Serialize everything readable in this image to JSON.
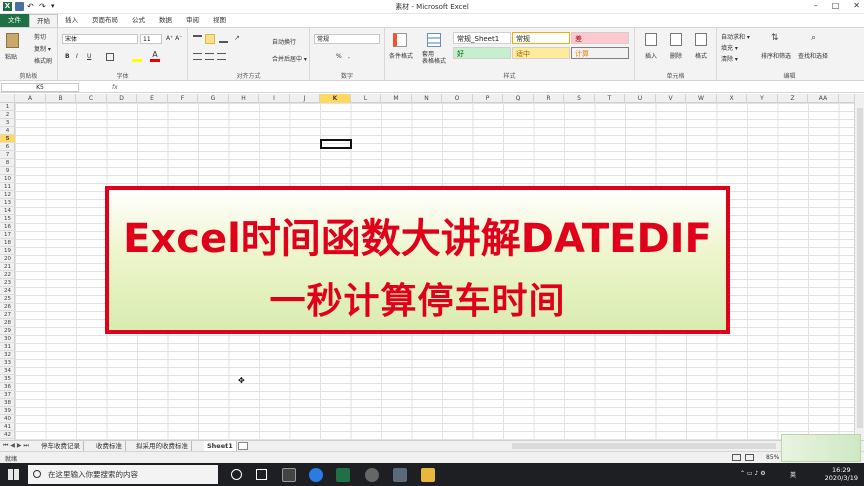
{
  "window": {
    "title": "素材 - Microsoft Excel",
    "controls": [
      "–",
      "□",
      "✕"
    ]
  },
  "qat": {
    "undo": "↶",
    "redo": "↷",
    "more": "▾"
  },
  "tabs": [
    "文件",
    "开始",
    "插入",
    "页面布局",
    "公式",
    "数据",
    "审阅",
    "视图"
  ],
  "ribbon": {
    "clipboard": {
      "label": "剪贴板",
      "paste": "粘贴",
      "cut": "剪切",
      "copy": "复制 ▾",
      "format_painter": "格式刷"
    },
    "font": {
      "label": "字体",
      "name": "宋体",
      "size": "11",
      "bold": "B",
      "italic": "I",
      "underline": "U"
    },
    "alignment": {
      "label": "对齐方式",
      "wrap": "自动换行",
      "merge": "合并后居中 ▾"
    },
    "number": {
      "label": "数字",
      "format": "常规",
      "percent": "%",
      "comma": ","
    },
    "styles": {
      "label": "样式",
      "conditional": "条件格式",
      "table": "套用\n表格格式",
      "cells": [
        {
          "text": "常规_Sheet1",
          "bg": "#ffffff"
        },
        {
          "text": "常规",
          "bg": "#ffffff"
        },
        {
          "text": "差",
          "bg": "#ffc7ce",
          "color": "#9c0006"
        },
        {
          "text": "好",
          "bg": "#c6efce",
          "color": "#006100"
        },
        {
          "text": "适中",
          "bg": "#ffeb9c",
          "color": "#9c6500"
        },
        {
          "text": "计算",
          "bg": "#f2f2f2",
          "color": "#fa7d00"
        }
      ]
    },
    "cells": {
      "label": "单元格",
      "insert": "插入",
      "delete": "删除",
      "format": "格式"
    },
    "editing": {
      "label": "编辑",
      "autosum": "自动求和 ▾",
      "fill": "填充 ▾",
      "clear": "清除 ▾",
      "sort": "排序和筛选",
      "find": "查找和选择"
    }
  },
  "formula_bar": {
    "name_box": "K5",
    "fx": "fx",
    "value": ""
  },
  "columns": [
    "A",
    "B",
    "C",
    "D",
    "E",
    "F",
    "G",
    "H",
    "I",
    "J",
    "K",
    "L",
    "M",
    "N",
    "O",
    "P",
    "Q",
    "R",
    "S",
    "T",
    "U",
    "V",
    "W",
    "X",
    "Y",
    "Z",
    "AA"
  ],
  "rows": [
    "1",
    "2",
    "3",
    "4",
    "5",
    "6",
    "7",
    "8",
    "9",
    "10",
    "11",
    "12",
    "13",
    "14",
    "15",
    "16",
    "17",
    "18",
    "19",
    "20",
    "21",
    "22",
    "23",
    "24",
    "25",
    "26",
    "27",
    "28",
    "29",
    "30",
    "31",
    "32",
    "33",
    "34",
    "35",
    "36",
    "37",
    "38",
    "39",
    "40",
    "41",
    "42"
  ],
  "banner": {
    "line1": "Excel时间函数大讲解DATEDIF",
    "line2": "一秒计算停车时间"
  },
  "sheets": [
    "停车收费记录",
    "收费标准",
    "拟采用的收费标准",
    "Sheet1"
  ],
  "active_sheet": "Sheet1",
  "status": {
    "ready": "就绪",
    "zoom": "85%"
  },
  "taskbar": {
    "search_placeholder": "在这里输入你要搜索的内容",
    "time": "16:29",
    "date": "2020/3/19",
    "ime": "英"
  }
}
